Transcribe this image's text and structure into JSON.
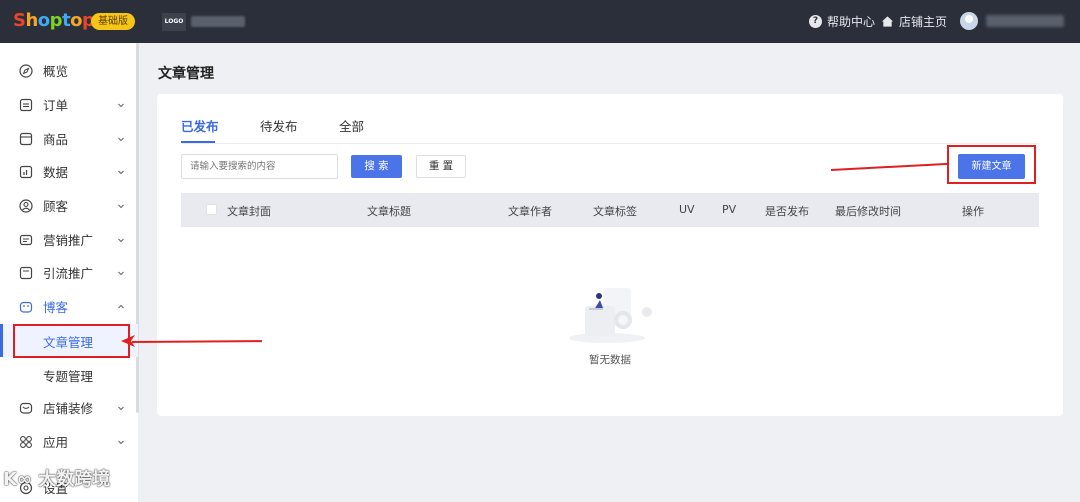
{
  "topbar": {
    "brand": "Shoptop",
    "plan_badge": "基础版",
    "store_logo_text": "LOGO",
    "help_label": "帮助中心",
    "store_home_label": "店铺主页"
  },
  "sidebar": {
    "items": [
      {
        "label": "概览",
        "icon": "compass-icon",
        "chevron": false
      },
      {
        "label": "订单",
        "icon": "order-icon",
        "chevron": true
      },
      {
        "label": "商品",
        "icon": "product-icon",
        "chevron": true
      },
      {
        "label": "数据",
        "icon": "chart-icon",
        "chevron": true
      },
      {
        "label": "顾客",
        "icon": "customer-icon",
        "chevron": true
      },
      {
        "label": "营销推广",
        "icon": "marketing-icon",
        "chevron": true
      },
      {
        "label": "引流推广",
        "icon": "traffic-icon",
        "chevron": true
      },
      {
        "label": "博客",
        "icon": "blog-icon",
        "chevron": true,
        "expanded": true
      },
      {
        "label": "店铺装修",
        "icon": "decorate-icon",
        "chevron": true
      },
      {
        "label": "应用",
        "icon": "apps-icon",
        "chevron": true
      },
      {
        "label": "设置",
        "icon": "settings-icon",
        "chevron": false
      }
    ],
    "blog_sub": [
      {
        "label": "文章管理",
        "active": true
      },
      {
        "label": "专题管理",
        "active": false
      }
    ]
  },
  "main": {
    "page_title": "文章管理",
    "tabs": [
      {
        "label": "已发布",
        "active": true
      },
      {
        "label": "待发布",
        "active": false
      },
      {
        "label": "全部",
        "active": false
      }
    ],
    "search_placeholder": "请输入要搜索的内容",
    "search_button": "搜 索",
    "reset_button": "重 置",
    "new_button": "新建文章",
    "columns": [
      "文章封面",
      "文章标题",
      "文章作者",
      "文章标签",
      "UV",
      "PV",
      "是否发布",
      "最后修改时间",
      "操作"
    ],
    "empty_text": "暂无数据"
  },
  "watermark": "大数跨境",
  "colors": {
    "accent": "#4b74e8",
    "topbar": "#2a2f3a",
    "annotation": "#e02020"
  }
}
